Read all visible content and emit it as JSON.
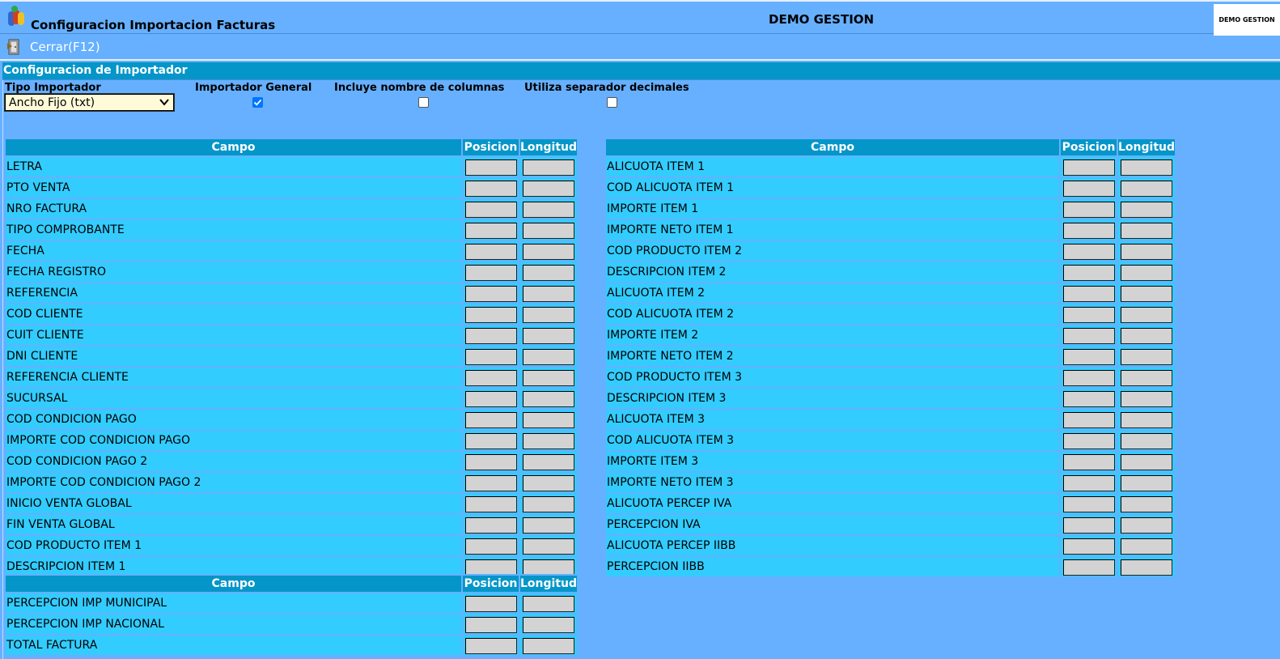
{
  "window": {
    "title": "Configuracion Importacion Facturas",
    "company": "DEMO GESTION",
    "logo_text": "DEMO GESTION"
  },
  "toolbar": {
    "close_label": "Cerrar(F12)"
  },
  "section": {
    "title": "Configuracion de Importador"
  },
  "options": {
    "tipo_label": "Tipo Importador",
    "tipo_value": "Ancho Fijo (txt)",
    "general_label": "Importador General",
    "general_checked": true,
    "columnas_label": "Incluye nombre de columnas",
    "columnas_checked": false,
    "decimales_label": "Utiliza separador decimales",
    "decimales_checked": false
  },
  "headers": {
    "campo": "Campo",
    "posicion": "Posicion",
    "longitud": "Longitud"
  },
  "table_left": [
    "LETRA",
    "PTO VENTA",
    "NRO FACTURA",
    "TIPO COMPROBANTE",
    "FECHA",
    "FECHA REGISTRO",
    "REFERENCIA",
    "COD CLIENTE",
    "CUIT CLIENTE",
    "DNI CLIENTE",
    "REFERENCIA CLIENTE",
    "SUCURSAL",
    "COD CONDICION PAGO",
    "IMPORTE COD CONDICION PAGO",
    "COD CONDICION PAGO 2",
    "IMPORTE COD CONDICION PAGO 2",
    "INICIO VENTA GLOBAL",
    "FIN VENTA GLOBAL",
    "COD PRODUCTO ITEM 1",
    "DESCRIPCION ITEM 1"
  ],
  "table_right": [
    "ALICUOTA ITEM 1",
    "COD ALICUOTA ITEM 1",
    "IMPORTE ITEM 1",
    "IMPORTE NETO ITEM 1",
    "COD PRODUCTO ITEM 2",
    "DESCRIPCION ITEM 2",
    "ALICUOTA ITEM 2",
    "COD ALICUOTA ITEM 2",
    "IMPORTE ITEM 2",
    "IMPORTE NETO ITEM 2",
    "COD PRODUCTO ITEM 3",
    "DESCRIPCION ITEM 3",
    "ALICUOTA ITEM 3",
    "COD ALICUOTA ITEM 3",
    "IMPORTE ITEM 3",
    "IMPORTE NETO ITEM 3",
    "ALICUOTA PERCEP IVA",
    "PERCEPCION IVA",
    "ALICUOTA PERCEP IIBB",
    "PERCEPCION IIBB"
  ],
  "table_bottom": [
    "PERCEPCION IMP MUNICIPAL",
    "PERCEPCION IMP NACIONAL",
    "TOTAL FACTURA"
  ]
}
